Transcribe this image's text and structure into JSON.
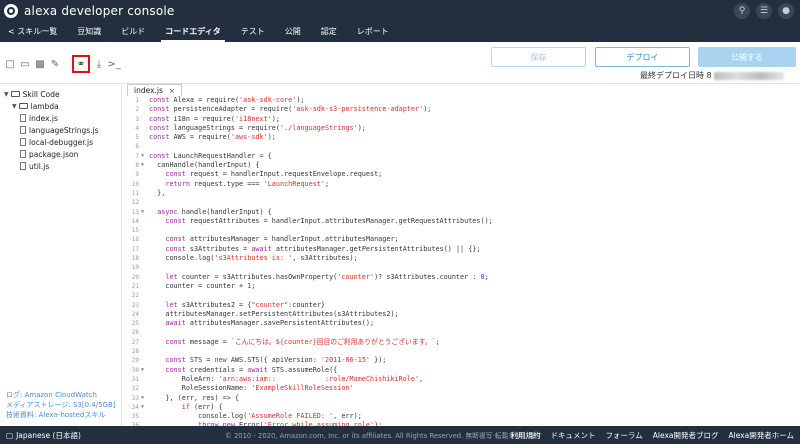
{
  "app": {
    "brand": "alexa developer console"
  },
  "nav": {
    "items": [
      {
        "label": "< スキル一覧"
      },
      {
        "label": "豆知識"
      },
      {
        "label": "ビルド"
      },
      {
        "label": "コードエディタ",
        "active": true
      },
      {
        "label": "テスト"
      },
      {
        "label": "公開"
      },
      {
        "label": "認定"
      },
      {
        "label": "レポート"
      }
    ]
  },
  "toolbar": {
    "save_label": "保存",
    "deploy_label": "デプロイ",
    "publish_label": "公開する",
    "last_deploy_label": "最終デプロイ日時 8"
  },
  "sidebar": {
    "tree": [
      {
        "label": "Skill Code",
        "type": "folder",
        "level": 0
      },
      {
        "label": "lambda",
        "type": "folder",
        "level": 1
      },
      {
        "label": "index.js",
        "type": "file",
        "level": 2
      },
      {
        "label": "languageStrings.js",
        "type": "file",
        "level": 2
      },
      {
        "label": "local-debugger.js",
        "type": "file",
        "level": 2
      },
      {
        "label": "package.json",
        "type": "file",
        "level": 2
      },
      {
        "label": "util.js",
        "type": "file",
        "level": 2
      }
    ],
    "footer": {
      "cloudwatch": "ログ: Amazon CloudWatch",
      "storage": "メディアストレージ: S3[0.4/5GB]",
      "docs": "技術資料: Alexa-hostedスキル"
    }
  },
  "editor": {
    "tab_label": "index.js",
    "tab_close": "×",
    "lines": [
      "const Alexa = require('ask-sdk-core');",
      "const persistenceAdapter = require('ask-sdk-s3-persistence-adapter');",
      "const i18n = require('i18next');",
      "const languageStrings = require('./languageStrings');",
      "const AWS = require('aws-sdk');",
      "",
      "const LaunchRequestHandler = {",
      "  canHandle(handlerInput) {",
      "    const request = handlerInput.requestEnvelope.request;",
      "    return request.type === 'LaunchRequest';",
      "  },",
      "",
      "  async handle(handlerInput) {",
      "    const requestAttributes = handlerInput.attributesManager.getRequestAttributes();",
      "",
      "    const attributesManager = handlerInput.attributesManager;",
      "    const s3Attributes = await attributesManager.getPersistentAttributes() || {};",
      "    console.log('s3Attributes is: ', s3Attributes);",
      "",
      "    let counter = s3Attributes.hasOwnProperty('counter')? s3Attributes.counter : 0;",
      "    counter = counter + 1;",
      "",
      "    let s3Attributes2 = {\"counter\":counter}",
      "    attributesManager.setPersistentAttributes(s3Attributes2);",
      "    await attributesManager.savePersistentAttributes();",
      "",
      "    const message = `こんにちは。${counter}回目のご利用ありがとうございます。`;",
      "",
      "    const STS = new AWS.STS({ apiVersion: '2011-06-15' });",
      "    const credentials = await STS.assumeRole({",
      "        RoleArn: 'arn:aws:iam::            :role/MameChishikiRole',",
      "        RoleSessionName: 'ExampleSkillRoleSession'",
      "    }, (err, res) => {",
      "        if (err) {",
      "            console.log('AssumeRole FAILED: ', err);",
      "            throw new Error('Error while assuming role');",
      "        }"
    ]
  },
  "footer": {
    "language": "Japanese (日本語)",
    "copyright": "© 2010 - 2020, Amazon.com, Inc. or its affiliates. All Rights Reserved. 無断複写·転載を禁じます",
    "links": [
      "利用規約",
      "ドキュメント",
      "フォーラム",
      "Alexa開発者ブログ",
      "Alexa開発者ホーム"
    ]
  }
}
